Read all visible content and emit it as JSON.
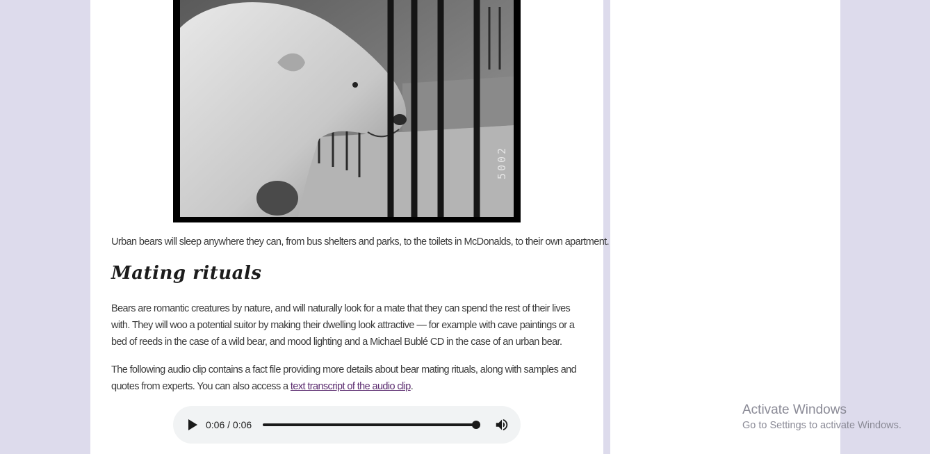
{
  "article": {
    "photo_caption_text": "Urban bears will sleep anywhere they can, from bus shelters and parks, to the toilets in McDonalds, to their own apartment.",
    "heading": "Mating rituals",
    "paragraph_2": "Bears are romantic creatures by nature, and will naturally look for a mate that they can spend the rest of their lives with. They will woo a potential suitor by making their dwelling look attractive — for example with cave paintings or a bed of reeds in the case of a wild bear, and mood lighting and a Michael Bublé CD in the case of an urban bear.",
    "paragraph_3_start": "The following audio clip contains a fact file providing more details about bear mating rituals, along with samples and quotes from experts. You can also access a ",
    "paragraph_3_link": "text transcript of the audio clip",
    "paragraph_3_end": ".",
    "photo_marking": "5002"
  },
  "audio_player": {
    "time_display": "0:06 / 0:06",
    "progress": 1.0,
    "icons": [
      "play-icon",
      "volume-icon"
    ]
  },
  "watermark": {
    "title": "Activate Windows",
    "subtitle": "Go to Settings to activate Windows."
  },
  "colors": {
    "page_bg": "#dddbec",
    "content_bg": "#ffffff",
    "link": "#5a2a6e"
  }
}
